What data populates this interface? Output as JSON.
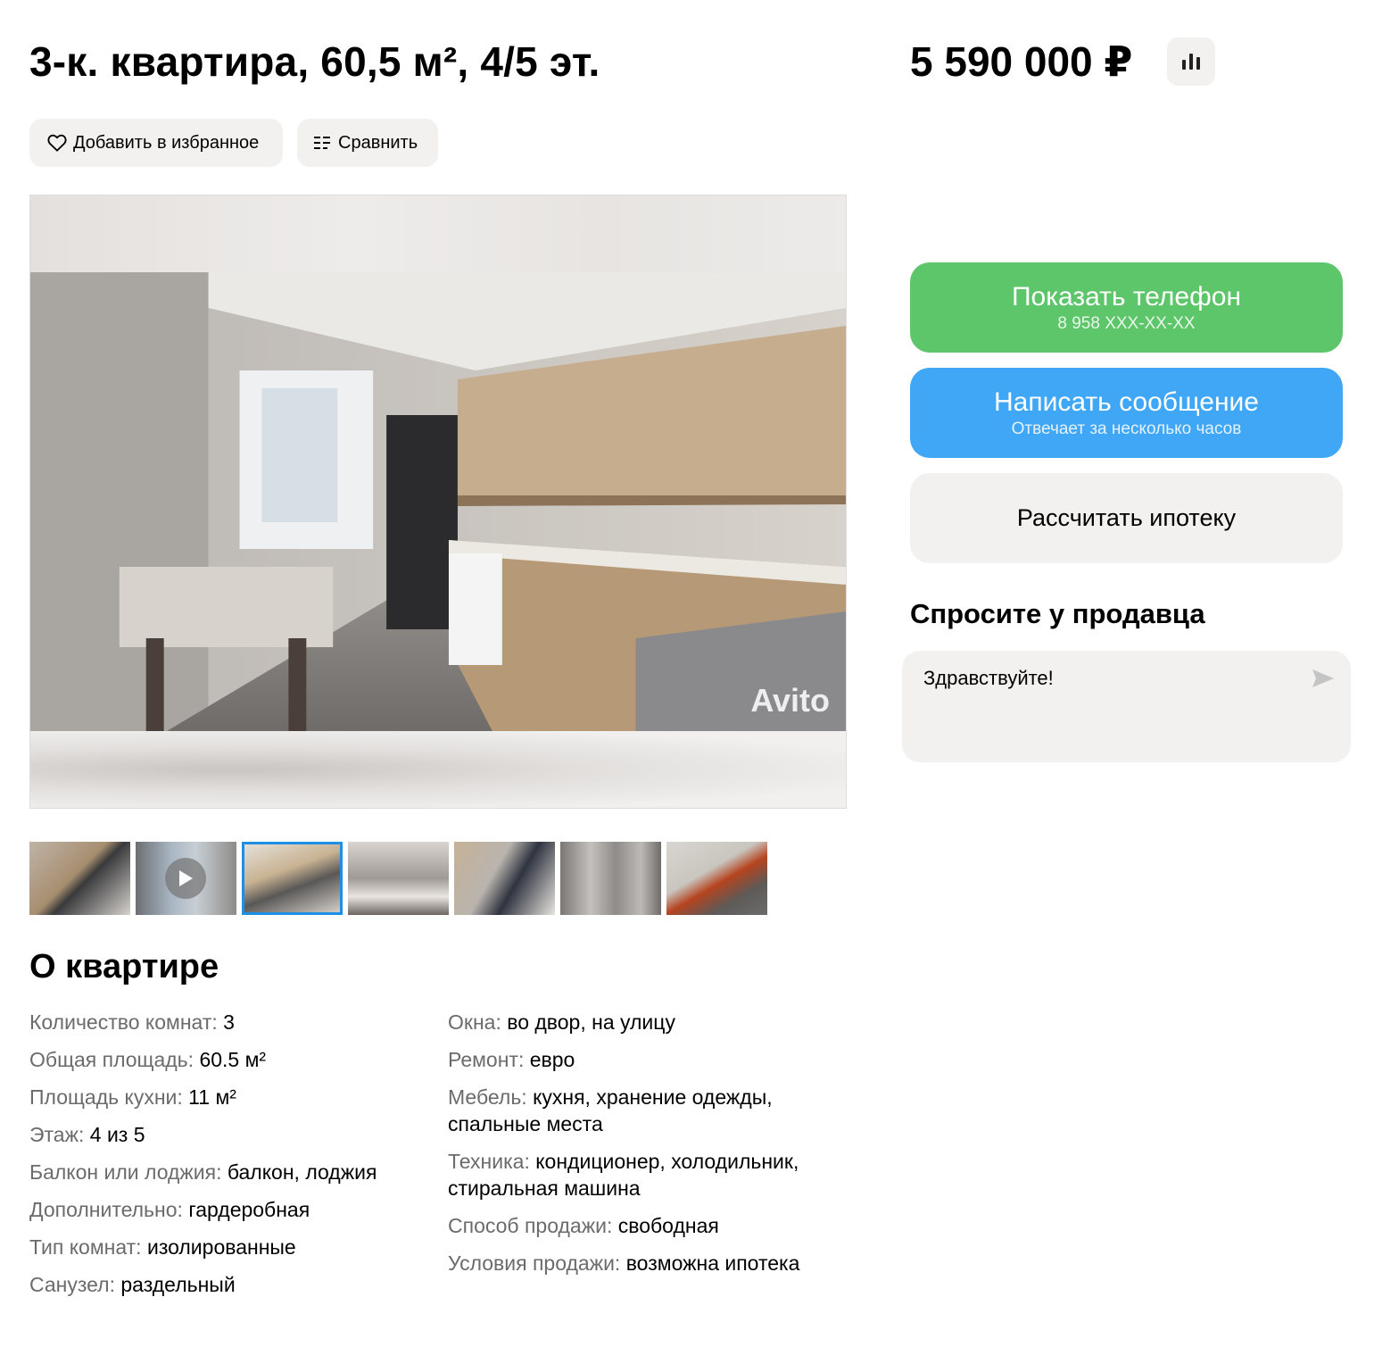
{
  "listing": {
    "title": "3-к. квартира, 60,5 м², 4/5 эт.",
    "price": "5 590 000 ₽"
  },
  "actions": {
    "favorite_label": "Добавить в избранное",
    "compare_label": "Сравнить"
  },
  "gallery": {
    "watermark": "Avito",
    "thumbnails_count": 7,
    "active_index": 2
  },
  "about": {
    "heading": "О квартире",
    "left": [
      {
        "label": "Количество комнат:",
        "value": "3"
      },
      {
        "label": "Общая площадь:",
        "value": "60.5 м²"
      },
      {
        "label": "Площадь кухни:",
        "value": "11 м²"
      },
      {
        "label": "Этаж:",
        "value": "4 из 5"
      },
      {
        "label": "Балкон или лоджия:",
        "value": "балкон, лоджия"
      },
      {
        "label": "Дополнительно:",
        "value": "гардеробная"
      },
      {
        "label": "Тип комнат:",
        "value": "изолированные"
      },
      {
        "label": "Санузел:",
        "value": "раздельный"
      }
    ],
    "right": [
      {
        "label": "Окна:",
        "value": "во двор, на улицу"
      },
      {
        "label": "Ремонт:",
        "value": "евро"
      },
      {
        "label": "Мебель:",
        "value": "кухня, хранение одежды, спальные места"
      },
      {
        "label": "Техника:",
        "value": "кондиционер, холодильник, стиральная машина"
      },
      {
        "label": "Способ продажи:",
        "value": "свободная"
      },
      {
        "label": "Условия продажи:",
        "value": "возможна ипотека"
      }
    ]
  },
  "contact": {
    "phone_label": "Показать телефон",
    "phone_masked": "8 958 XXX-XX-XX",
    "message_label": "Написать сообщение",
    "message_sub": "Отвечает за несколько часов",
    "mortgage_label": "Рассчитать ипотеку",
    "ask_heading": "Спросите у продавца",
    "ask_text": "Здравствуйте!"
  },
  "colors": {
    "green": "#5ec66a",
    "blue": "#40a7f7",
    "pill_bg": "#f2f1f0",
    "active_thumb": "#1f8fe6"
  }
}
